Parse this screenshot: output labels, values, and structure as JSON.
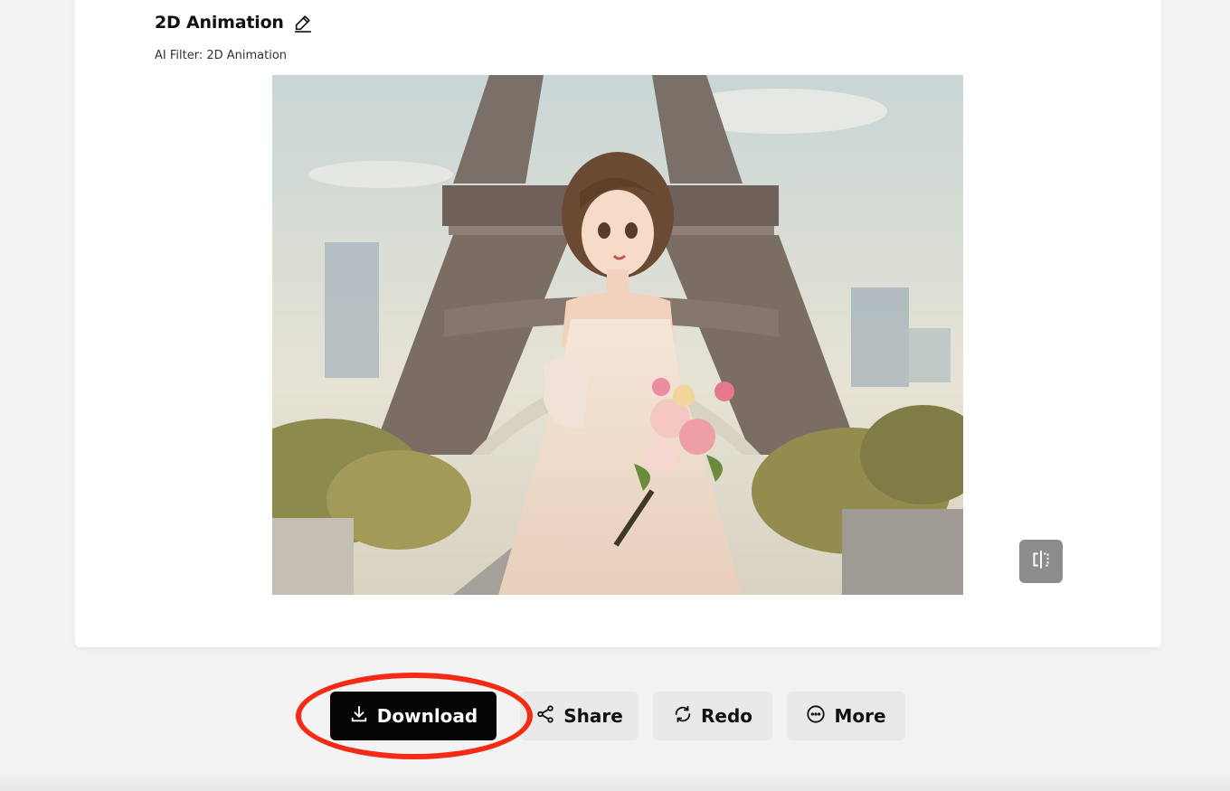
{
  "header": {
    "title": "2D Animation",
    "subtitle": "AI Filter: 2D Animation"
  },
  "result_image": {
    "description_icon": "anime-girl-eiffel-tower-image"
  },
  "compare_button": {
    "icon": "compare-split-icon"
  },
  "actions": {
    "download_label": "Download",
    "share_label": "Share",
    "redo_label": "Redo",
    "more_label": "More"
  },
  "colors": {
    "primary_button": "#050505",
    "secondary_button": "#e9e9e9",
    "annotation": "#f42a14"
  }
}
